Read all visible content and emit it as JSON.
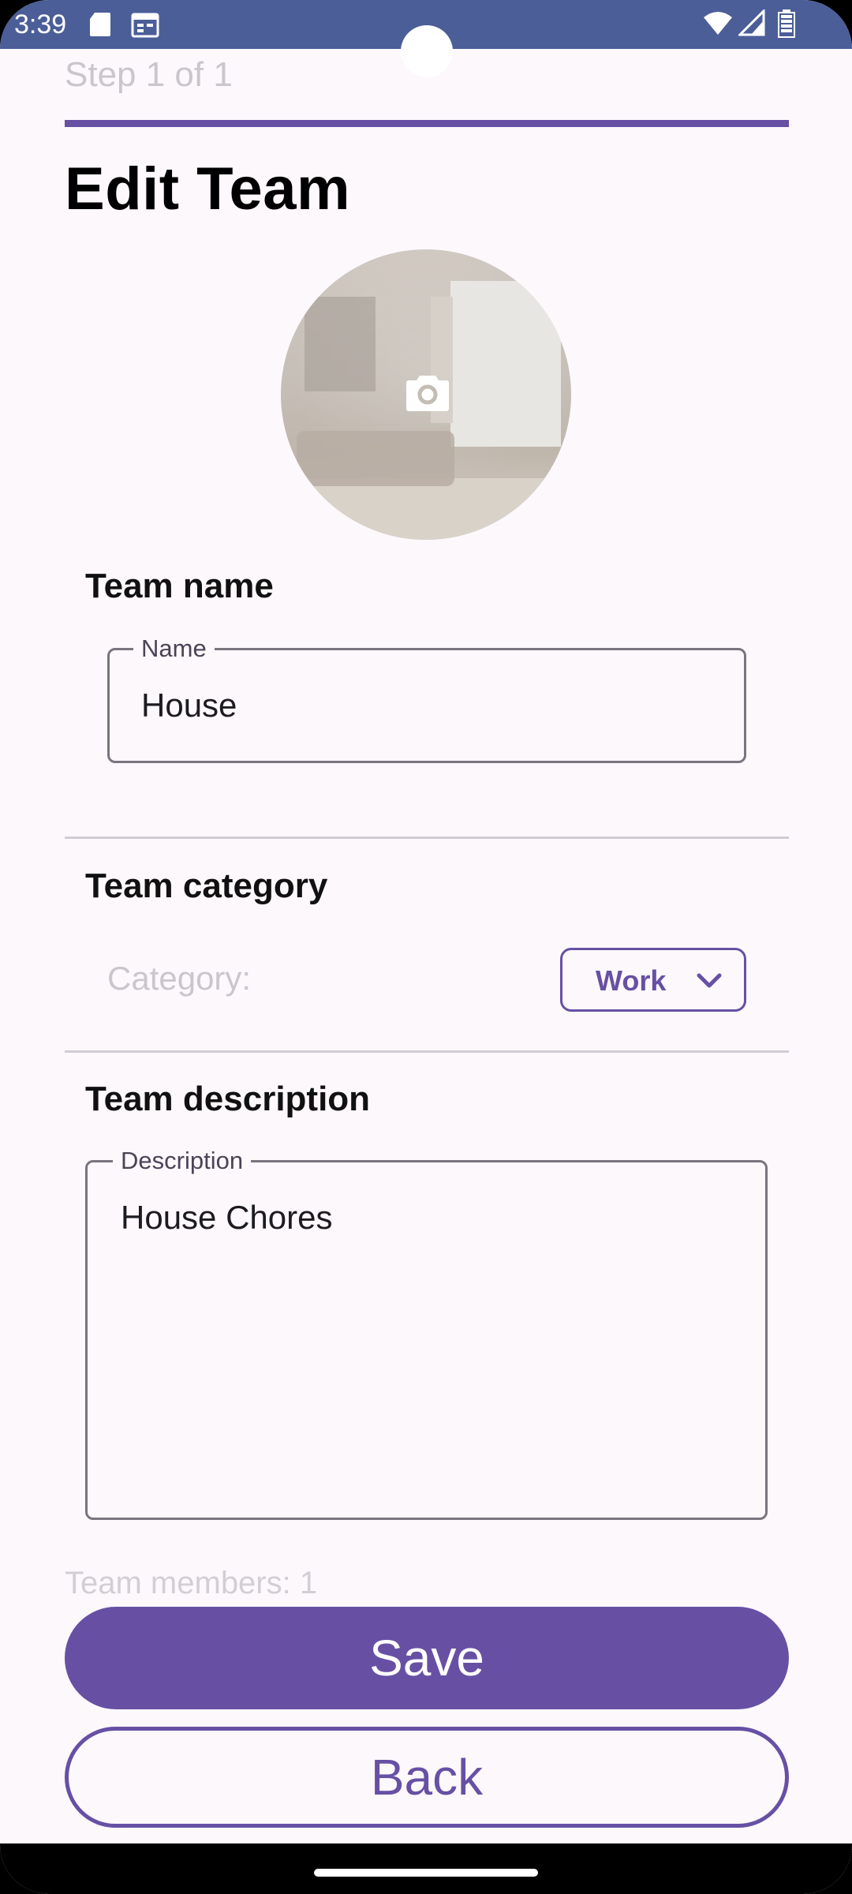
{
  "status_bar": {
    "time": "3:39",
    "icons": [
      "sd-card-icon",
      "calendar-icon",
      "wifi-icon",
      "signal-icon",
      "battery-icon"
    ]
  },
  "header": {
    "step": "Step 1 of 1",
    "title": "Edit Team"
  },
  "avatar": {
    "icon": "camera-icon"
  },
  "team_name": {
    "section_label": "Team name",
    "field_label": "Name",
    "value": "House"
  },
  "team_category": {
    "section_label": "Team category",
    "category_label": "Category:",
    "selected": "Work"
  },
  "team_description": {
    "section_label": "Team description",
    "field_label": "Description",
    "value": "House Chores"
  },
  "members": {
    "text": "Team members: 1"
  },
  "actions": {
    "save_label": "Save",
    "back_label": "Back"
  },
  "colors": {
    "accent": "#6750a4",
    "status_bar": "#4b5e98",
    "background": "#fdf8fc"
  }
}
